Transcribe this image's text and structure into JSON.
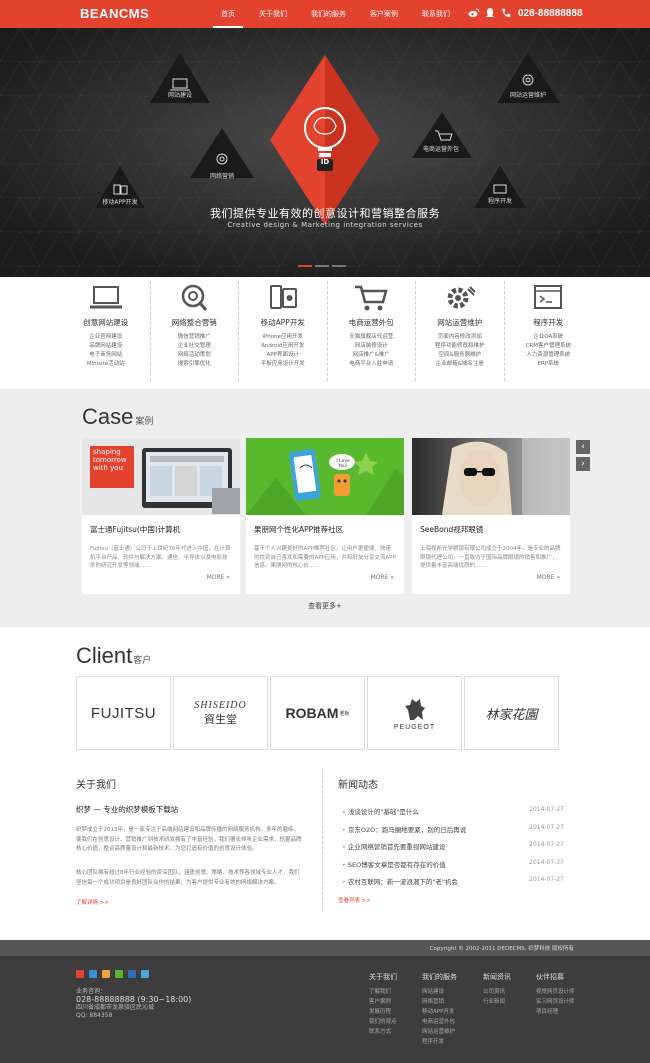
{
  "header": {
    "logo": "BEANCMS",
    "nav": [
      "首页",
      "关于我们",
      "我们的服务",
      "客户案例",
      "联系我们"
    ],
    "phone": "028-88888888"
  },
  "hero": {
    "labels": [
      "网站建设",
      "网络营销",
      "移动APP开发",
      "网站运营维护",
      "电商运营外包",
      "程序开发"
    ],
    "badge": "ID",
    "title": "我们提供专业有效的创意设计和营销整合服务",
    "subtitle": "Creative design & Marketing integration services"
  },
  "services": [
    {
      "title": "创意网站建设",
      "icon": "laptop-icon",
      "items": [
        "企业官网建设",
        "品牌网站建设",
        "电子商务网站",
        "Minisite活动站"
      ]
    },
    {
      "title": "网络整合营销",
      "icon": "search-target-icon",
      "items": [
        "微信营销推广",
        "企业社交管理",
        "网络活动策划",
        "搜索引擎优化"
      ]
    },
    {
      "title": "移动APP开发",
      "icon": "mobile-apps-icon",
      "items": [
        "iPhone应用开发",
        "Android应用开发",
        "APP界面设计",
        "平板应用设计开发"
      ]
    },
    {
      "title": "电商运营外包",
      "icon": "cart-icon",
      "items": [
        "天猫旗舰店代运营",
        "网店装修设计",
        "网店推广&推广",
        "电商平台入驻申请"
      ]
    },
    {
      "title": "网站运营维护",
      "icon": "gear-icon",
      "items": [
        "页面内容修改添加",
        "程序功能修改和维护",
        "空间&服务器维护",
        "企业邮箱&域名注册"
      ]
    },
    {
      "title": "程序开发",
      "icon": "terminal-icon",
      "items": [
        "企业OA系统",
        "CRM客户管理系统",
        "人力资源管理系统",
        "ERP系统"
      ]
    }
  ],
  "case": {
    "title": "Case",
    "title_cn": "案例",
    "see_more": "查看更多+",
    "cards": [
      {
        "title": "富士通Fujitsu(中国)计算机",
        "desc": "Fujitsu（富士通）公司于上世纪70年代进入中国，在计算机平台产品、软件与解决方案、通信、半导体以及电影技术的研究开发等领域......",
        "more": "MORE »",
        "img_text": "shaping tomorrow with you"
      },
      {
        "title": "果朋网个性化APP推荐社区",
        "desc": "基于个人兴趣爱好的APP推荐社区，让用户更便捷、快速的找到自己喜欢和需要的APP应用，并和好友分享交流APP信息。果朋网的核心价......",
        "more": "MORE »",
        "img_text": "I Love You!"
      },
      {
        "title": "SeeBond视邦眼镜",
        "desc": "上海视邦光学眼镜有限公司成立于2004年，是专业的品牌眼镜代理公司，一直致力于国际品牌眼镜的销售和推广，提供着丰富高端优质的......",
        "more": "MORE »",
        "img_text": ""
      }
    ]
  },
  "client": {
    "title": "Client",
    "title_cn": "客户",
    "logos": [
      "FUJITSU",
      "SHISEIDO",
      "資生堂",
      "ROBAM",
      "老板",
      "PEUGEOT",
      "林家花園"
    ]
  },
  "about": {
    "heading": "关于我们",
    "subtitle": "织梦 — 专业的织梦模板下载站",
    "p1": "织梦成立于2013年，是一家专注于高端网站建设和品牌传播的网络服务机构。多年的磨练，使我们在创意设计、营销推广到技术研发拥有了丰富经验，我们擅长倾听企业需求，挖掘品牌核心价值，整合高质量设计和最新技术，为您打造有价值的创意设计体验。",
    "p2": "核心团队拥有超过8年行业经验的资深团队，涵盖创意、策略、技术等各领域专业人才，我们坚信每一个成功项目是良好团队合作的结果，为客户提供专业有效的网络解决方案。",
    "link": "了解详情 >>"
  },
  "news": {
    "heading": "新闻动态",
    "items": [
      {
        "title": "浅谈设计的\"基础\"是什么",
        "date": "2014-07-27"
      },
      {
        "title": "京东O2O：跑马圈地要紧，别的日后再说",
        "date": "2014-07-27"
      },
      {
        "title": "企业网络营销首先要重视网站建设",
        "date": "2014-07-27"
      },
      {
        "title": "SEO博客文章是否都有存在的价值",
        "date": "2014-07-27"
      },
      {
        "title": "农村互联网：新一波浪潮下的\"老\"机会",
        "date": "2014-07-27"
      }
    ],
    "link": "查看列表 >>"
  },
  "footer": {
    "copyright": "Copyright © 2002-2011 DEDECMS. 织梦科技 版权所有",
    "hotline_label": "业务咨询：",
    "hotline": "028-88888888 (9:30~18:00)",
    "address": "四川省成都市龙泉驿区民沁城",
    "qq": "QQ: 884358",
    "columns": [
      {
        "title": "关于我们",
        "items": [
          "了解我们",
          "客户案例",
          "发展历程",
          "我们的观点",
          "联系方式"
        ]
      },
      {
        "title": "我们的服务",
        "items": [
          "网站建设",
          "网络营销",
          "移动APP开发",
          "电商运营外包",
          "网站运营维护",
          "程序开发"
        ]
      },
      {
        "title": "新闻资讯",
        "items": [
          "公司资讯",
          "行业新闻"
        ]
      },
      {
        "title": "伙伴招募",
        "items": [
          "视觉网页设计师",
          "实习网页设计师",
          "项目经理"
        ]
      }
    ]
  },
  "colors": {
    "brand": "#e2422e",
    "hero_bg": "#2b2b2b",
    "footer_bg": "#3d3d3d"
  }
}
